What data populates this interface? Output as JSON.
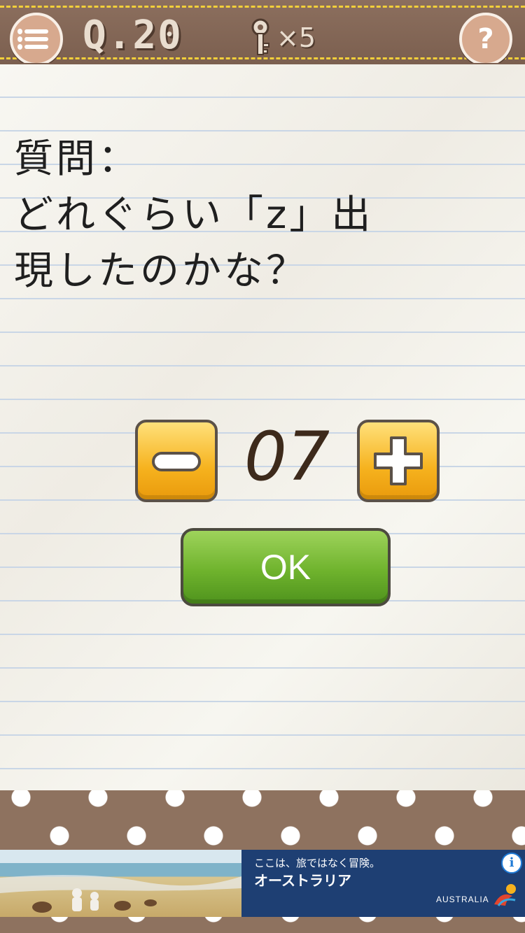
{
  "header": {
    "question_label": "Q.20",
    "key_count": "×5",
    "help_label": "?"
  },
  "question": {
    "text": "質問：\nどれぐらい「z」出\n現したのかな？"
  },
  "counter": {
    "value": "07"
  },
  "ok_button": {
    "label": "OK"
  },
  "ad": {
    "tagline": "ここは、旅ではなく冒険。",
    "title": "オーストラリア",
    "brand": "AUSTRALIA",
    "info_label": "i"
  },
  "colors": {
    "header_brown": "#7b5f4f",
    "stitch_yellow": "#f2cf3a",
    "button_orange": "#f6b21e",
    "ok_green": "#6fb32d",
    "ad_blue": "#1e3f73"
  },
  "icons": [
    "menu-icon",
    "key-icon",
    "help-icon",
    "minus-icon",
    "plus-icon",
    "info-icon"
  ]
}
